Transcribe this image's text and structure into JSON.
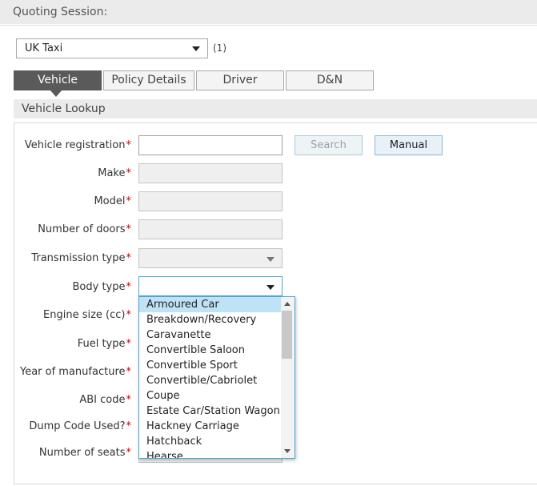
{
  "header": {
    "title": "Quoting Session:"
  },
  "product": {
    "selected": "UK Taxi",
    "count": "(1)"
  },
  "tabs": [
    {
      "label": "Vehicle",
      "active": true
    },
    {
      "label": "Policy Details",
      "active": false
    },
    {
      "label": "Driver",
      "active": false
    },
    {
      "label": "D&N",
      "active": false
    }
  ],
  "section": {
    "title": "Vehicle Lookup"
  },
  "required_marker": "*",
  "fields": {
    "registration": {
      "label": "Vehicle registration",
      "value": ""
    },
    "make": {
      "label": "Make",
      "value": ""
    },
    "model": {
      "label": "Model",
      "value": ""
    },
    "doors": {
      "label": "Number of doors",
      "value": ""
    },
    "transmission": {
      "label": "Transmission type",
      "value": ""
    },
    "body": {
      "label": "Body type",
      "value": ""
    },
    "engine": {
      "label": "Engine size (cc)"
    },
    "fuel": {
      "label": "Fuel type"
    },
    "year": {
      "label": "Year of manufacture"
    },
    "abi": {
      "label": "ABI code"
    },
    "dump": {
      "label": "Dump Code Used?"
    },
    "seats": {
      "label": "Number of seats"
    }
  },
  "buttons": {
    "search": "Search",
    "manual": "Manual"
  },
  "body_type_options": [
    "Armoured Car",
    "Breakdown/Recovery",
    "Caravanette",
    "Convertible Saloon",
    "Convertible Sport",
    "Convertible/Cabriolet",
    "Coupe",
    "Estate Car/Station Wagon",
    "Hackney Carriage",
    "Hatchback",
    "Hearse"
  ],
  "colors": {
    "required": "#cc0000",
    "active_tab": "#5a5a5a",
    "focus": "#4aa7d8",
    "highlight": "#bfe2f6"
  }
}
